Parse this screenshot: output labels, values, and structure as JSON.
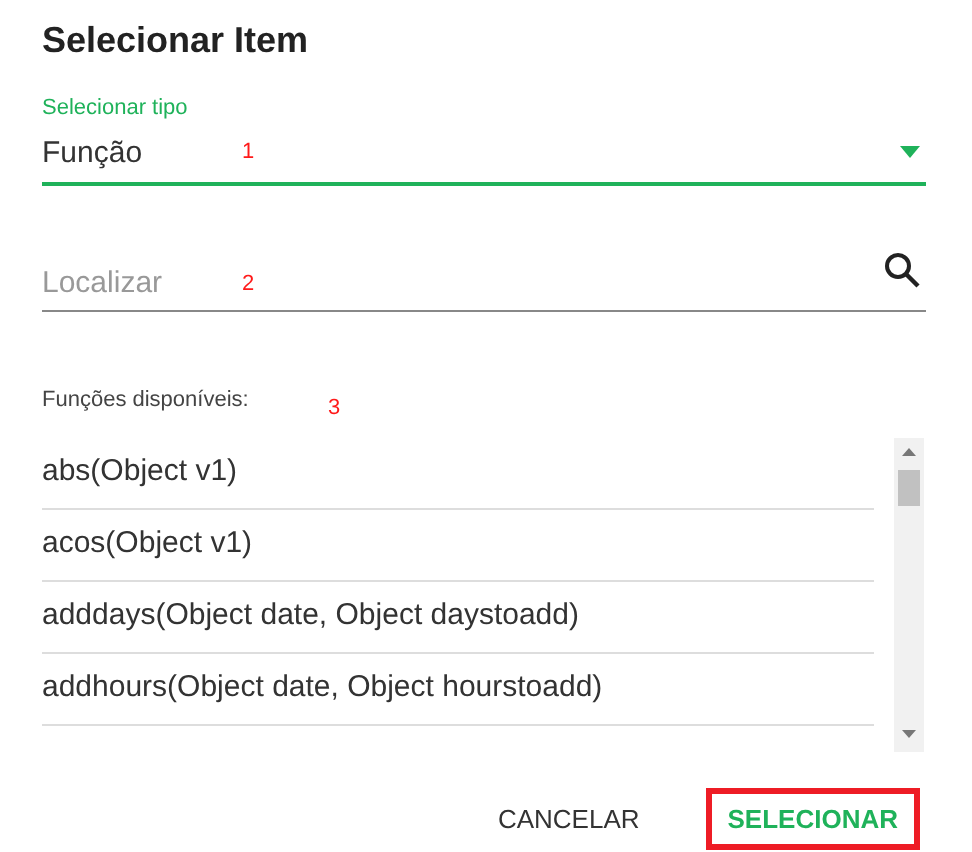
{
  "dialog": {
    "title": "Selecionar Item"
  },
  "type_select": {
    "label": "Selecionar tipo",
    "value": "Função",
    "focused": true,
    "annotation": "1"
  },
  "search": {
    "placeholder": "Localizar",
    "annotation": "2"
  },
  "list": {
    "label": "Funções disponíveis:",
    "annotation": "3",
    "items": [
      {
        "text": "abs(Object v1)"
      },
      {
        "text": "acos(Object v1)"
      },
      {
        "text": "adddays(Object date, Object daystoadd)"
      },
      {
        "text": "addhours(Object date, Object hourstoadd)"
      }
    ]
  },
  "buttons": [
    {
      "label": "CANCELAR",
      "kind": "secondary",
      "highlighted": false
    },
    {
      "label": "SELECIONAR",
      "kind": "primary",
      "highlighted": true
    }
  ]
}
